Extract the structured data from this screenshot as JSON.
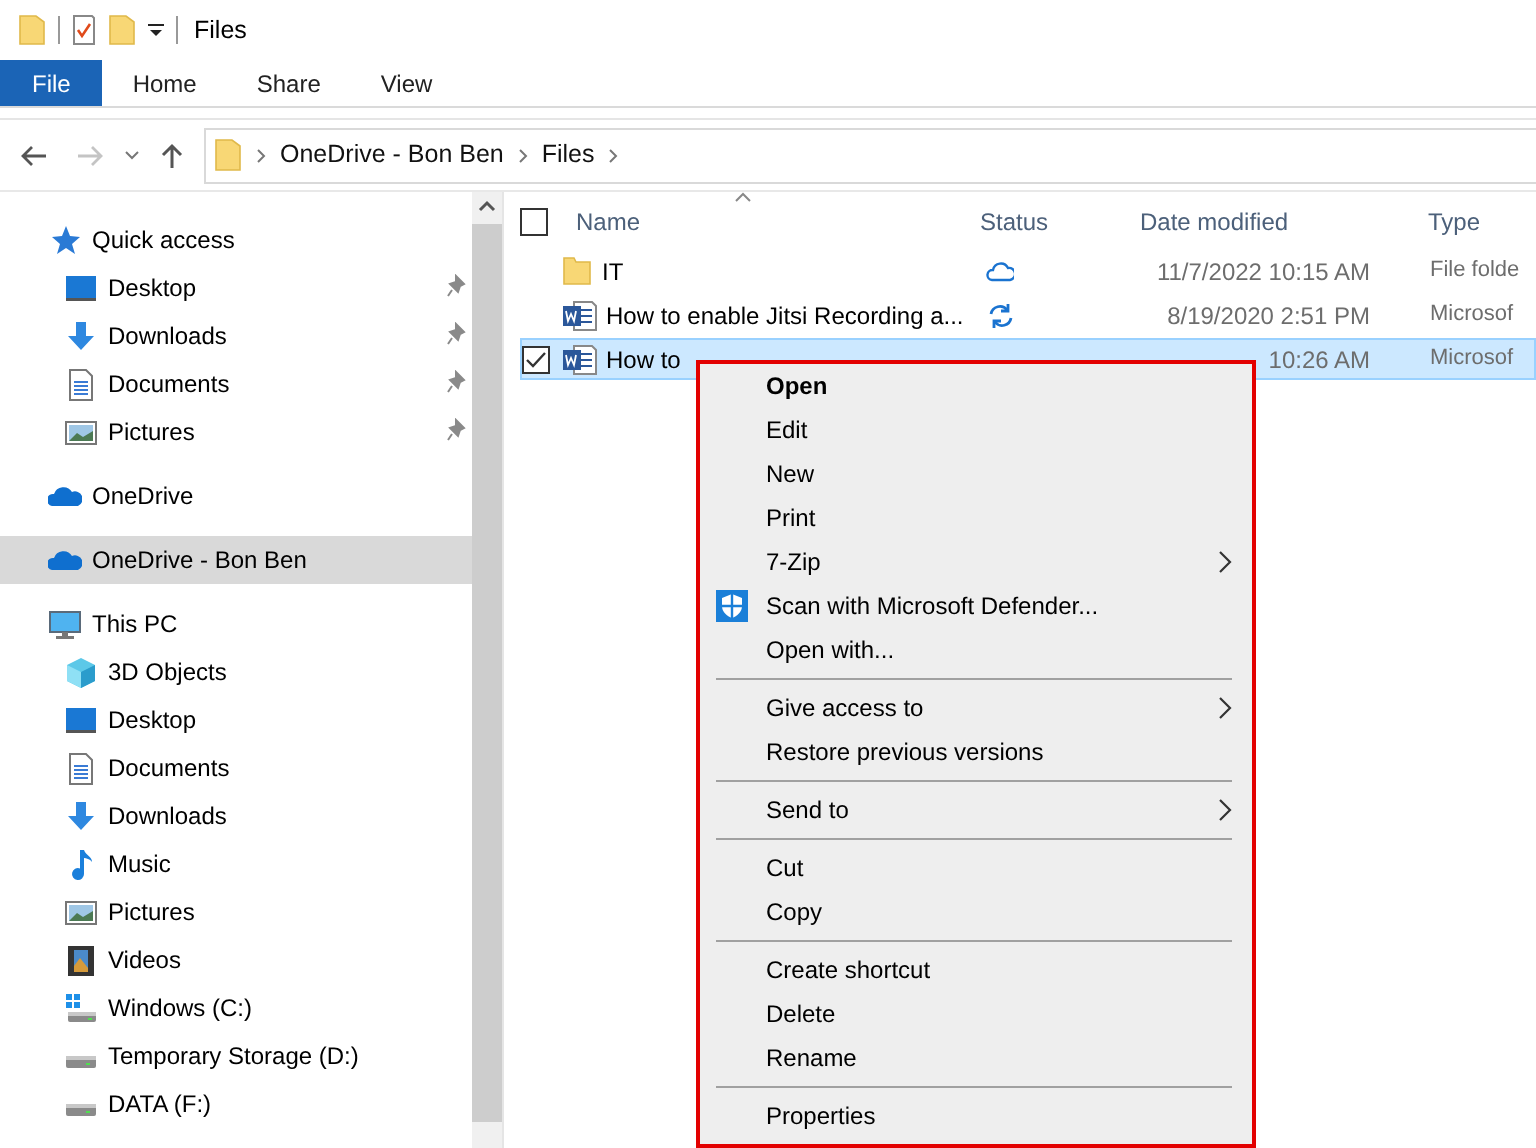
{
  "title_bar": {
    "title": "Files"
  },
  "ribbon_tabs": [
    {
      "label": "File",
      "selected": true
    },
    {
      "label": "Home",
      "selected": false
    },
    {
      "label": "Share",
      "selected": false
    },
    {
      "label": "View",
      "selected": false
    }
  ],
  "address_bar": {
    "segments": [
      "OneDrive - Bon Ben",
      "Files"
    ]
  },
  "sidebar": {
    "items": [
      {
        "label": "Quick access",
        "kind": "star",
        "selected": false,
        "children": [
          {
            "label": "Desktop",
            "kind": "desktop",
            "pinned": true,
            "selected": false
          },
          {
            "label": "Downloads",
            "kind": "download",
            "pinned": true,
            "selected": false
          },
          {
            "label": "Documents",
            "kind": "document",
            "pinned": true,
            "selected": false
          },
          {
            "label": "Pictures",
            "kind": "pictures",
            "pinned": true,
            "selected": false
          }
        ]
      },
      {
        "label": "OneDrive",
        "kind": "cloud",
        "selected": false
      },
      {
        "label": "OneDrive - Bon Ben",
        "kind": "cloud",
        "selected": true
      },
      {
        "label": "This PC",
        "kind": "pc",
        "selected": false,
        "children": [
          {
            "label": "3D Objects",
            "kind": "cube",
            "pinned": false,
            "selected": false
          },
          {
            "label": "Desktop",
            "kind": "desktop",
            "pinned": false,
            "selected": false
          },
          {
            "label": "Documents",
            "kind": "document",
            "pinned": false,
            "selected": false
          },
          {
            "label": "Downloads",
            "kind": "download",
            "pinned": false,
            "selected": false
          },
          {
            "label": "Music",
            "kind": "music",
            "pinned": false,
            "selected": false
          },
          {
            "label": "Pictures",
            "kind": "pictures",
            "pinned": false,
            "selected": false
          },
          {
            "label": "Videos",
            "kind": "video",
            "pinned": false,
            "selected": false
          },
          {
            "label": "Windows (C:)",
            "kind": "system-drive",
            "pinned": false,
            "selected": false
          },
          {
            "label": "Temporary Storage (D:)",
            "kind": "drive",
            "pinned": false,
            "selected": false
          },
          {
            "label": "DATA (F:)",
            "kind": "drive",
            "pinned": false,
            "selected": false
          }
        ]
      }
    ]
  },
  "table": {
    "columns": [
      "Name",
      "Status",
      "Date modified",
      "Type"
    ],
    "header_checkbox": {
      "checked": false
    },
    "rows": [
      {
        "name": "IT",
        "kind": "folder",
        "synced": true,
        "syncing": false,
        "date": "11/7/2022 10:15 AM",
        "type": "File folde",
        "selected": false
      },
      {
        "name": "How to enable Jitsi Recording a...",
        "kind": "word",
        "synced": false,
        "syncing": true,
        "date": "8/19/2020 2:51 PM",
        "type": "Microsof",
        "selected": false
      },
      {
        "name": "How to",
        "kind": "word",
        "synced": false,
        "syncing": false,
        "date": "10:26 AM",
        "type": "Microsof",
        "selected": true
      }
    ]
  },
  "context_menu": {
    "items": [
      {
        "kind": "item",
        "label": "Open",
        "default": true,
        "submenu": false
      },
      {
        "kind": "item",
        "label": "Edit",
        "default": false,
        "submenu": false
      },
      {
        "kind": "item",
        "label": "New",
        "default": false,
        "submenu": false
      },
      {
        "kind": "item",
        "label": "Print",
        "default": false,
        "submenu": false
      },
      {
        "kind": "item",
        "label": "7-Zip",
        "default": false,
        "submenu": true
      },
      {
        "kind": "app-item",
        "label": "Scan with Microsoft Defender...",
        "default": false,
        "submenu": false
      },
      {
        "kind": "item",
        "label": "Open with...",
        "default": false,
        "submenu": false
      },
      {
        "kind": "separator"
      },
      {
        "kind": "item",
        "label": "Give access to",
        "default": false,
        "submenu": true
      },
      {
        "kind": "item",
        "label": "Restore previous versions",
        "default": false,
        "submenu": false
      },
      {
        "kind": "separator"
      },
      {
        "kind": "item",
        "label": "Send to",
        "default": false,
        "submenu": true
      },
      {
        "kind": "separator"
      },
      {
        "kind": "item",
        "label": "Cut",
        "default": false,
        "submenu": false
      },
      {
        "kind": "item",
        "label": "Copy",
        "default": false,
        "submenu": false
      },
      {
        "kind": "separator"
      },
      {
        "kind": "item",
        "label": "Create shortcut",
        "default": false,
        "submenu": false
      },
      {
        "kind": "item",
        "label": "Delete",
        "default": false,
        "submenu": false
      },
      {
        "kind": "item",
        "label": "Rename",
        "default": false,
        "submenu": false
      },
      {
        "kind": "separator"
      },
      {
        "kind": "item",
        "label": "Properties",
        "default": false,
        "submenu": false
      }
    ]
  }
}
